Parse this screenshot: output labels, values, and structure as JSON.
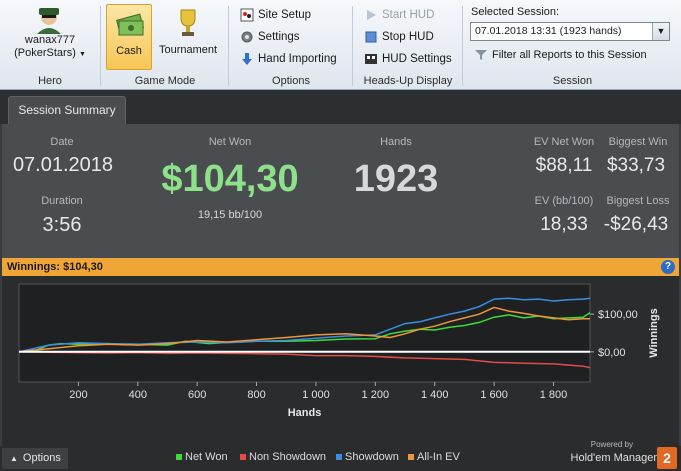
{
  "ribbon": {
    "hero": {
      "name": "wanax777",
      "site": "(PokerStars)",
      "group_label": "Hero"
    },
    "game_mode": {
      "cash_label": "Cash",
      "tournament_label": "Tournament",
      "group_label": "Game Mode",
      "active": "Cash"
    },
    "options": {
      "site_setup": "Site Setup",
      "settings": "Settings",
      "hand_importing": "Hand Importing",
      "group_label": "Options"
    },
    "hud": {
      "start": "Start HUD",
      "stop": "Stop HUD",
      "settings": "HUD Settings",
      "group_label": "Heads-Up Display"
    },
    "session": {
      "label": "Selected Session:",
      "value": "07.01.2018 13:31 (1923 hands)",
      "filter": "Filter all Reports to this Session",
      "group_label": "Session"
    }
  },
  "tabs": [
    {
      "label": "Session Summary"
    }
  ],
  "summary": {
    "date_label": "Date",
    "date": "07.01.2018",
    "duration_label": "Duration",
    "duration": "3:56",
    "net_won_label": "Net Won",
    "net_won": "$104,30",
    "bb_per_100": "19,15 bb/100",
    "hands_label": "Hands",
    "hands": "1923",
    "ev_net_won_label": "EV Net Won",
    "ev_net_won": "$88,11",
    "ev_bb_label": "EV (bb/100)",
    "ev_bb": "18,33",
    "biggest_win_label": "Biggest Win",
    "biggest_win": "$33,73",
    "biggest_loss_label": "Biggest Loss",
    "biggest_loss": "-$26,43"
  },
  "winnings_bar": {
    "text": "Winnings: $104,30",
    "help": "?"
  },
  "chart_data": {
    "type": "line",
    "xlabel": "Hands",
    "ylabel": "Winnings",
    "x_ticks": [
      "200",
      "400",
      "600",
      "800",
      "1 000",
      "1 200",
      "1 400",
      "1 600",
      "1 800"
    ],
    "y_ticks": [
      "$100,00",
      "$0,00"
    ],
    "xlim": [
      0,
      1923
    ],
    "ylim": [
      -80,
      180
    ],
    "series": [
      {
        "name": "Net Won",
        "color": "#3ddc3d",
        "x": [
          0,
          60,
          100,
          140,
          200,
          300,
          400,
          500,
          560,
          640,
          700,
          800,
          900,
          1000,
          1100,
          1200,
          1250,
          1300,
          1350,
          1400,
          1450,
          1500,
          1550,
          1600,
          1650,
          1700,
          1750,
          1800,
          1850,
          1900,
          1923
        ],
        "y": [
          0,
          5,
          18,
          22,
          20,
          22,
          20,
          18,
          28,
          22,
          25,
          28,
          28,
          30,
          34,
          35,
          48,
          55,
          60,
          58,
          65,
          70,
          78,
          92,
          98,
          90,
          95,
          88,
          90,
          92,
          104
        ]
      },
      {
        "name": "Non Showdown",
        "color": "#e84a4a",
        "x": [
          0,
          100,
          200,
          300,
          400,
          500,
          600,
          700,
          800,
          900,
          1000,
          1100,
          1200,
          1300,
          1400,
          1500,
          1600,
          1700,
          1800,
          1900,
          1923
        ],
        "y": [
          0,
          -1,
          -2,
          -3,
          -2,
          -4,
          -3,
          -4,
          -5,
          -6,
          -10,
          -10,
          -12,
          -16,
          -18,
          -20,
          -28,
          -30,
          -32,
          -38,
          -42
        ]
      },
      {
        "name": "Showdown",
        "color": "#3b8fe0",
        "x": [
          0,
          100,
          200,
          300,
          400,
          500,
          600,
          700,
          800,
          900,
          1000,
          1100,
          1200,
          1250,
          1300,
          1350,
          1400,
          1450,
          1500,
          1550,
          1600,
          1650,
          1700,
          1750,
          1800,
          1850,
          1900,
          1923
        ],
        "y": [
          0,
          18,
          24,
          22,
          20,
          24,
          26,
          24,
          28,
          30,
          36,
          42,
          45,
          60,
          75,
          80,
          90,
          100,
          108,
          120,
          140,
          142,
          138,
          140,
          135,
          138,
          140,
          142
        ]
      },
      {
        "name": "All-In EV",
        "color": "#f0953a",
        "x": [
          0,
          100,
          200,
          300,
          400,
          500,
          600,
          700,
          800,
          900,
          1000,
          1100,
          1200,
          1250,
          1300,
          1350,
          1400,
          1450,
          1500,
          1550,
          1600,
          1650,
          1700,
          1750,
          1800,
          1850,
          1900,
          1923
        ],
        "y": [
          0,
          8,
          16,
          20,
          18,
          22,
          30,
          26,
          32,
          38,
          45,
          48,
          42,
          38,
          48,
          60,
          68,
          80,
          90,
          100,
          118,
          108,
          102,
          95,
          90,
          85,
          88,
          88
        ]
      },
      {
        "name": "Zero baseline",
        "color": "#ffffff",
        "x": [
          0,
          1923
        ],
        "y": [
          0,
          0
        ]
      }
    ]
  },
  "bottom": {
    "options": "Options",
    "powered": "Powered by",
    "brand": "Hold'em Manager",
    "logo": "2"
  }
}
